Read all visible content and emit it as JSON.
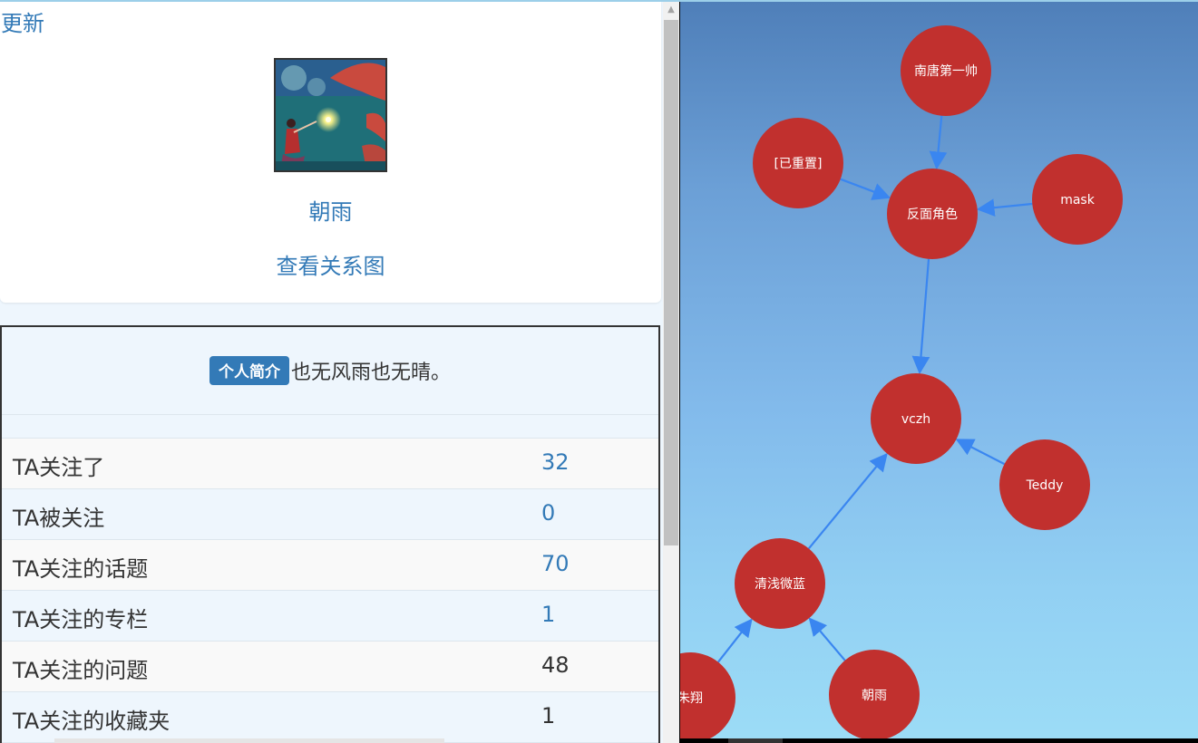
{
  "profile": {
    "update_label": "更新",
    "name": "朝雨",
    "graph_link_label": "查看关系图"
  },
  "bio": {
    "badge_label": "个人简介",
    "text": "也无风雨也无晴。"
  },
  "stats": [
    {
      "label": "TA关注了",
      "value": "32"
    },
    {
      "label": "TA被关注",
      "value": "0"
    },
    {
      "label": "TA关注的话题",
      "value": "70"
    },
    {
      "label": "TA关注的专栏",
      "value": "1"
    },
    {
      "label": "TA关注的问题",
      "value": "48"
    },
    {
      "label": "TA关注的收藏夹",
      "value": "1"
    }
  ],
  "graph": {
    "node_color": "#c1302e",
    "edge_color": "#3a86f0",
    "nodes": [
      "南唐第一帅",
      "[已重置]",
      "反面角色",
      "mask",
      "vczh",
      "Teddy",
      "清浅微蓝",
      "朱翔",
      "朝雨"
    ]
  }
}
